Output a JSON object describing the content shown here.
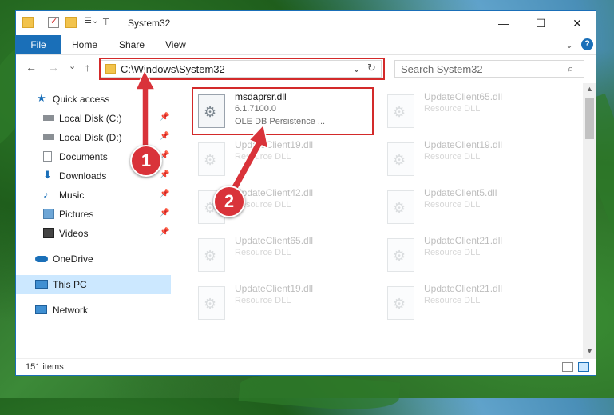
{
  "window": {
    "title": "System32",
    "controls": {
      "minimize": "—",
      "maximize": "☐",
      "close": "✕"
    }
  },
  "ribbon": {
    "tabs": [
      "File",
      "Home",
      "Share",
      "View"
    ],
    "help": "?",
    "collapse": "⌄"
  },
  "address": {
    "path": "C:\\Windows\\System32",
    "refresh": "↻",
    "dropdown": "⌄"
  },
  "search": {
    "placeholder": "Search System32",
    "icon": "⌕"
  },
  "nav_buttons": {
    "back": "←",
    "forward": "→",
    "recent": "⌄",
    "up": "↑"
  },
  "sidebar": {
    "items": [
      {
        "label": "Quick access",
        "icon": "star-icon"
      },
      {
        "label": "Local Disk (C:)",
        "icon": "drive-icon",
        "pinned": true
      },
      {
        "label": "Local Disk (D:)",
        "icon": "drive-icon",
        "pinned": true
      },
      {
        "label": "Documents",
        "icon": "documents-icon",
        "pinned": true
      },
      {
        "label": "Downloads",
        "icon": "downloads-icon",
        "pinned": true
      },
      {
        "label": "Music",
        "icon": "music-icon",
        "pinned": true
      },
      {
        "label": "Pictures",
        "icon": "pictures-icon",
        "pinned": true
      },
      {
        "label": "Videos",
        "icon": "videos-icon",
        "pinned": true
      },
      {
        "label": "OneDrive",
        "icon": "onedrive-icon"
      },
      {
        "label": "This PC",
        "icon": "pc-icon",
        "selected": true
      },
      {
        "label": "Network",
        "icon": "network-icon"
      }
    ]
  },
  "files": [
    {
      "name": "msdaprsr.dll",
      "version": "6.1.7100.0",
      "desc": "OLE DB Persistence ...",
      "highlighted": true
    },
    {
      "name": "UpdateClient65.dll",
      "desc": "Resource DLL"
    },
    {
      "name": "UpdateClient19.dll",
      "desc": "Resource DLL"
    },
    {
      "name": "UpdateClient19.dll",
      "desc": "Resource DLL"
    },
    {
      "name": "UpdateClient42.dll",
      "desc": "Resource DLL"
    },
    {
      "name": "UpdateClient5.dll",
      "desc": "Resource DLL"
    },
    {
      "name": "UpdateClient65.dll",
      "desc": "Resource DLL"
    },
    {
      "name": "UpdateClient21.dll",
      "desc": "Resource DLL"
    },
    {
      "name": "UpdateClient19.dll",
      "desc": "Resource DLL"
    },
    {
      "name": "UpdateClient21.dll",
      "desc": "Resource DLL"
    }
  ],
  "status": {
    "item_count": "151 items"
  },
  "markers": [
    "1",
    "2"
  ],
  "colors": {
    "accent": "#1a6fb8",
    "highlight": "#d32a2a",
    "selection": "#cce8ff"
  }
}
